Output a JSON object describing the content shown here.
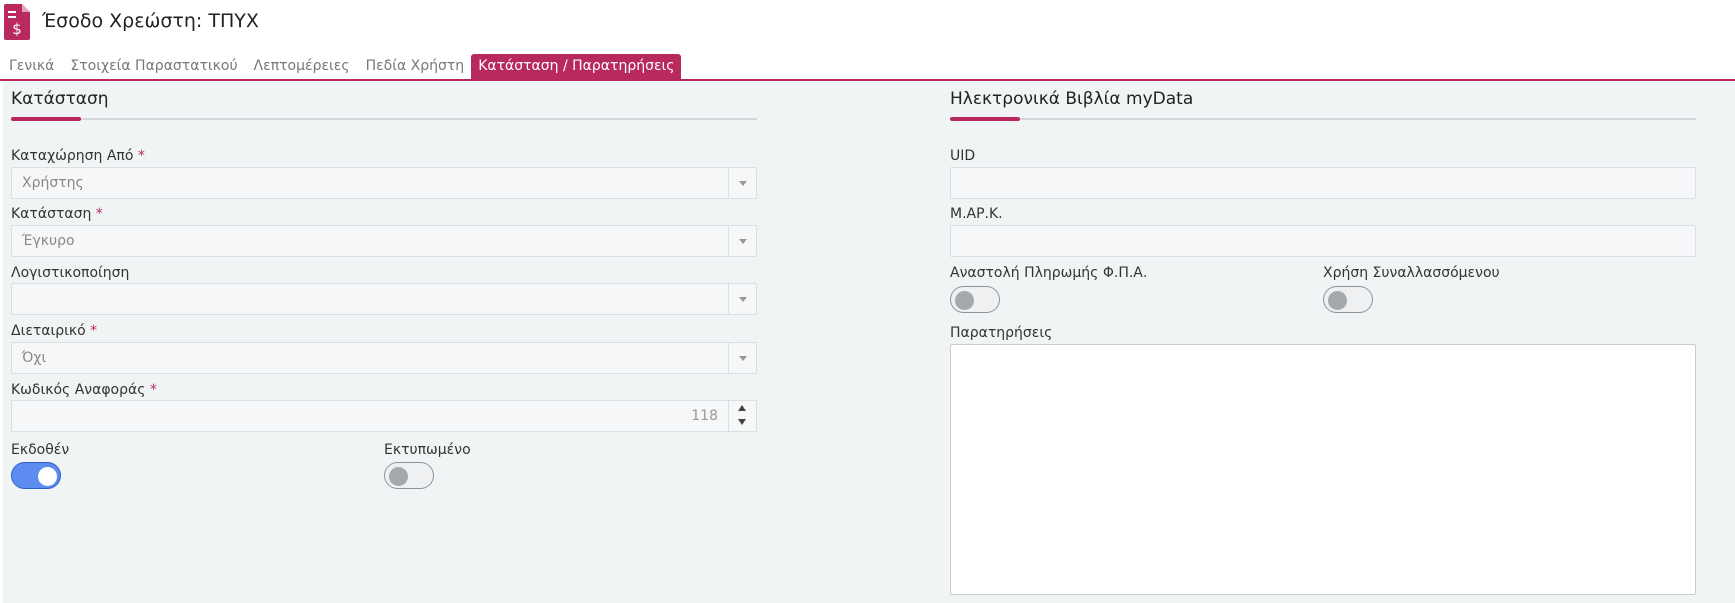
{
  "header": {
    "title": "Έσοδο Χρεώστη: ΤΠΥΧ",
    "icon": "invoice-dollar-icon"
  },
  "tabs": [
    {
      "label": "Γενικά",
      "active": false
    },
    {
      "label": "Στοιχεία Παραστατικού",
      "active": false
    },
    {
      "label": "Λεπτομέρειες",
      "active": false
    },
    {
      "label": "Πεδία Χρήστη",
      "active": false
    },
    {
      "label": "Κατάσταση / Παρατηρήσεις",
      "active": true
    }
  ],
  "status_section": {
    "title": "Κατάσταση",
    "entered_by": {
      "label": "Καταχώρηση Από",
      "required": "*",
      "value": "Χρήστης"
    },
    "status": {
      "label": "Κατάσταση",
      "required": "*",
      "value": "Έγκυρο"
    },
    "accounting": {
      "label": "Λογιστικοποίηση",
      "value": ""
    },
    "intercompany": {
      "label": "Διεταιρικό",
      "required": "*",
      "value": "Όχι"
    },
    "reference_code": {
      "label": "Κωδικός Αναφοράς",
      "required": "*",
      "value": "118"
    },
    "issued": {
      "label": "Εκδοθέν",
      "on": true
    },
    "printed": {
      "label": "Εκτυπωμένο",
      "on": false
    }
  },
  "mydata_section": {
    "title": "Ηλεκτρονικά Βιβλία myData",
    "uid": {
      "label": "UID",
      "value": ""
    },
    "mark": {
      "label": "Μ.ΑΡ.Κ.",
      "value": ""
    },
    "vat_suspension": {
      "label": "Αναστολή Πληρωμής Φ.Π.Α.",
      "on": false
    },
    "counterparty_use": {
      "label": "Χρήση Συναλλασσόμενου",
      "on": false
    },
    "notes": {
      "label": "Παρατηρήσεις",
      "value": ""
    }
  },
  "colors": {
    "accent": "#b8295e",
    "toggle_on": "#5c8cf0"
  }
}
